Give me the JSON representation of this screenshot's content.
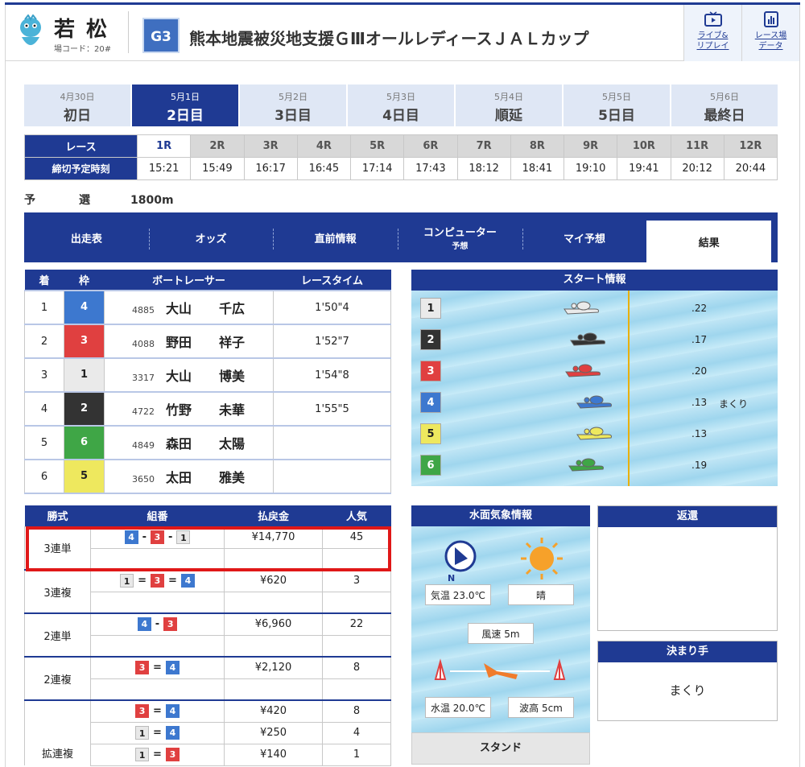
{
  "header": {
    "venue": "若松",
    "venue_code": "場コード：20#",
    "grade": "G3",
    "race_title": "熊本地震被災地支援ＧⅢオールレディースＪＡＬカップ",
    "buttons": [
      {
        "line1": "ライブ&",
        "line2": "リプレイ",
        "icon": "tv-icon"
      },
      {
        "line1": "レース場",
        "line2": "データ",
        "icon": "chart-icon"
      }
    ]
  },
  "days": [
    {
      "date": "4月30日",
      "label": "初日"
    },
    {
      "date": "5月1日",
      "label": "2日目",
      "active": true
    },
    {
      "date": "5月2日",
      "label": "3日目"
    },
    {
      "date": "5月3日",
      "label": "4日目"
    },
    {
      "date": "5月4日",
      "label": "順延"
    },
    {
      "date": "5月5日",
      "label": "5日目"
    },
    {
      "date": "5月6日",
      "label": "最終日"
    }
  ],
  "races": {
    "race_label": "レース",
    "time_label": "締切予定時刻",
    "numbers": [
      "1R",
      "2R",
      "3R",
      "4R",
      "5R",
      "6R",
      "7R",
      "8R",
      "9R",
      "10R",
      "11R",
      "12R"
    ],
    "times": [
      "15:21",
      "15:49",
      "16:17",
      "16:45",
      "17:14",
      "17:43",
      "18:12",
      "18:41",
      "19:10",
      "19:41",
      "20:12",
      "20:44"
    ],
    "active_index": 0
  },
  "section": {
    "name": "予　選",
    "distance": "1800m"
  },
  "nav": [
    {
      "label": "出走表"
    },
    {
      "label": "オッズ"
    },
    {
      "label": "直前情報"
    },
    {
      "label": "コンピューター",
      "sub": "予想"
    },
    {
      "label": "マイ予想"
    },
    {
      "label": "結果",
      "active": true
    }
  ],
  "result": {
    "headers": [
      "着",
      "枠",
      "ボートレーサー",
      "レースタイム"
    ],
    "rows": [
      {
        "place": "1",
        "frame": "4",
        "reg": "4885",
        "last": "大山",
        "first": "千広",
        "time": "1'50\"4"
      },
      {
        "place": "2",
        "frame": "3",
        "reg": "4088",
        "last": "野田",
        "first": "祥子",
        "time": "1'52\"7"
      },
      {
        "place": "3",
        "frame": "1",
        "reg": "3317",
        "last": "大山",
        "first": "博美",
        "time": "1'54\"8"
      },
      {
        "place": "4",
        "frame": "2",
        "reg": "4722",
        "last": "竹野",
        "first": "未華",
        "time": "1'55\"5"
      },
      {
        "place": "5",
        "frame": "6",
        "reg": "4849",
        "last": "森田",
        "first": "太陽",
        "time": ""
      },
      {
        "place": "6",
        "frame": "5",
        "reg": "3650",
        "last": "太田",
        "first": "雅美",
        "time": ""
      }
    ]
  },
  "start_info": {
    "title": "スタート情報",
    "rows": [
      {
        "course": "1",
        "st": ".22",
        "note": ""
      },
      {
        "course": "2",
        "st": ".17",
        "note": ""
      },
      {
        "course": "3",
        "st": ".20",
        "note": ""
      },
      {
        "course": "4",
        "st": ".13",
        "note": "まくり"
      },
      {
        "course": "5",
        "st": ".13",
        "note": ""
      },
      {
        "course": "6",
        "st": ".19",
        "note": ""
      }
    ]
  },
  "payout": {
    "headers": [
      "勝式",
      "組番",
      "払戻金",
      "人気"
    ],
    "rows": [
      {
        "kind": "3連単",
        "combo": [
          "4",
          "-",
          "3",
          "-",
          "1"
        ],
        "amount": "¥14,770",
        "pop": "45"
      },
      {
        "kind": "3連複",
        "combo": [
          "1",
          "=",
          "3",
          "=",
          "4"
        ],
        "amount": "¥620",
        "pop": "3"
      },
      {
        "kind": "2連単",
        "combo": [
          "4",
          "-",
          "3"
        ],
        "amount": "¥6,960",
        "pop": "22"
      },
      {
        "kind": "2連複",
        "combo": [
          "3",
          "=",
          "4"
        ],
        "amount": "¥2,120",
        "pop": "8"
      }
    ],
    "wide_kind": "拡連複",
    "wide": [
      {
        "combo": [
          "3",
          "=",
          "4"
        ],
        "amount": "¥420",
        "pop": "8"
      },
      {
        "combo": [
          "1",
          "=",
          "4"
        ],
        "amount": "¥250",
        "pop": "4"
      },
      {
        "combo": [
          "1",
          "=",
          "3"
        ],
        "amount": "¥140",
        "pop": "1"
      }
    ]
  },
  "weather": {
    "title": "水面気象情報",
    "compass": "N",
    "temp": "気温 23.0℃",
    "condition": "晴",
    "wind": "風速 5m",
    "water_temp": "水温 20.0℃",
    "wave": "波高 5cm",
    "footer": "スタンド"
  },
  "refund": {
    "title": "返還",
    "value": ""
  },
  "kimarite": {
    "title": "決まり手",
    "value": "まくり"
  },
  "frame_colors": {
    "1": "#eaeaea",
    "2": "#333333",
    "3": "#e04040",
    "4": "#3d78cf",
    "5": "#eee85e",
    "6": "#3fa646"
  }
}
